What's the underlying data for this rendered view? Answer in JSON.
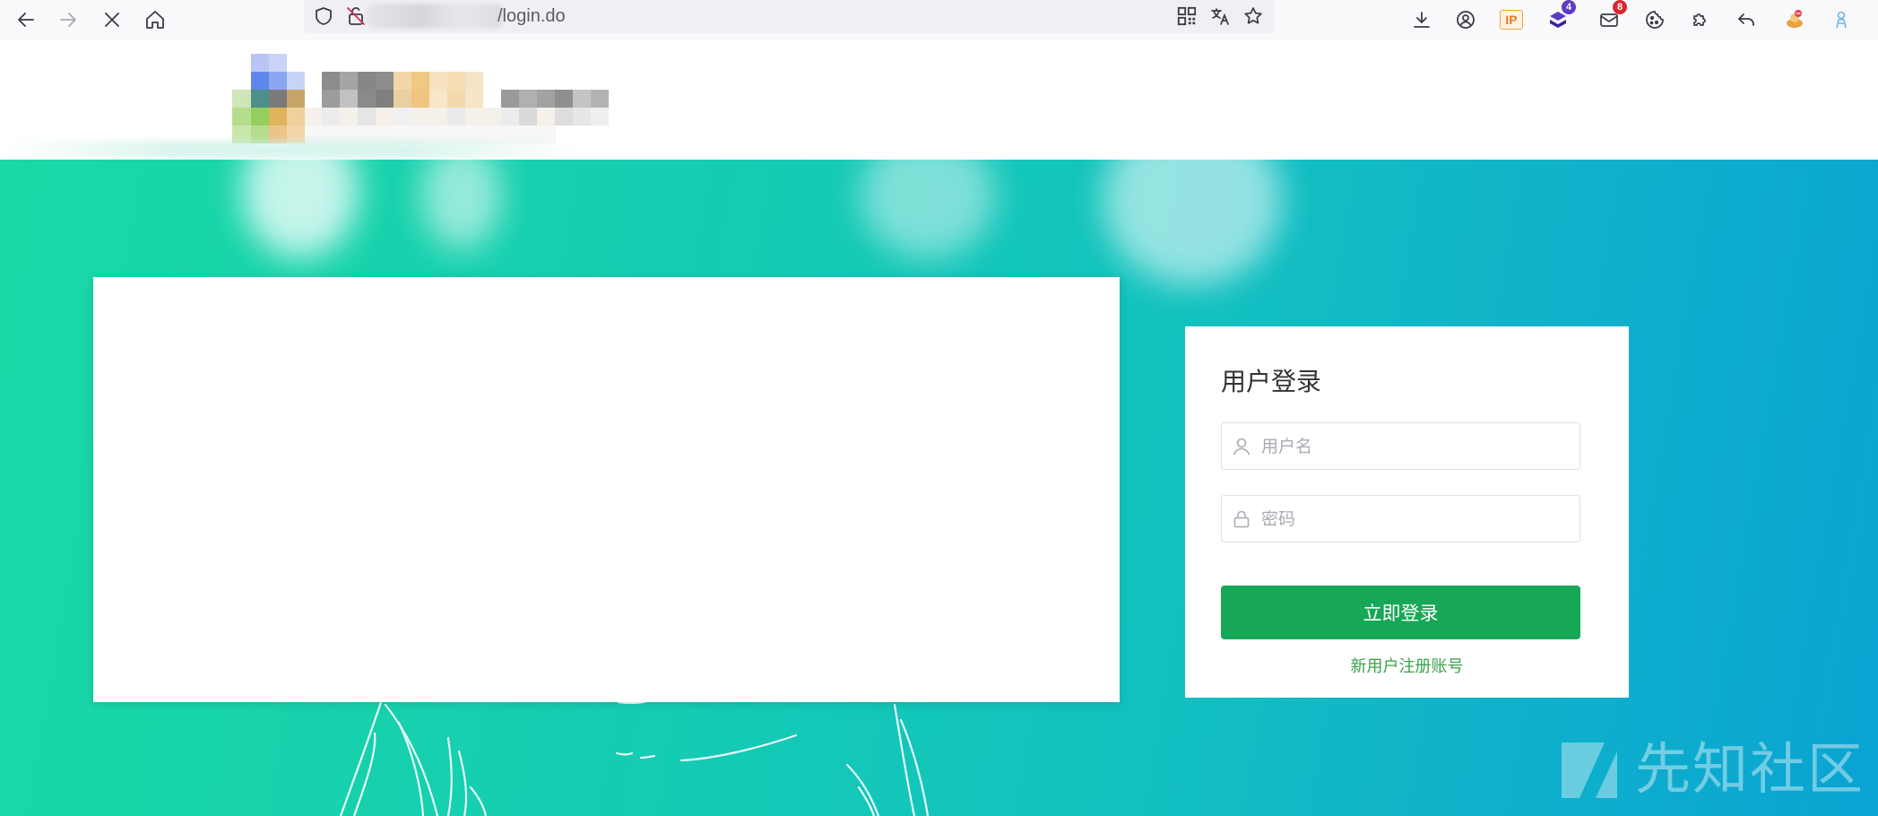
{
  "browser": {
    "url_visible": "/login.do",
    "extensions": {
      "ip_label": "IP",
      "layers_badge": "4",
      "mail_badge": "8"
    },
    "icons": [
      "back-icon",
      "forward-icon",
      "stop-icon",
      "home-icon",
      "shield-icon",
      "insecure-lock-icon",
      "qr-code-icon",
      "translate-icon",
      "bookmark-star-icon",
      "download-icon",
      "account-icon",
      "ip-extension-icon",
      "layers-extension-icon",
      "mail-extension-icon",
      "cookie-icon",
      "extensions-puzzle-icon",
      "undo-icon",
      "extension-avatar-icon",
      "extension-figure-icon"
    ]
  },
  "login": {
    "title": "用户登录",
    "username_placeholder": "用户名",
    "password_placeholder": "密码",
    "submit_label": "立即登录",
    "register_link": "新用户注册账号"
  },
  "watermark": {
    "text": "先知社区"
  },
  "colors": {
    "primary_button": "#16a857",
    "register_link": "#3aa04a",
    "hero_start": "#1ad9a6",
    "hero_end": "#0aa3d2"
  }
}
